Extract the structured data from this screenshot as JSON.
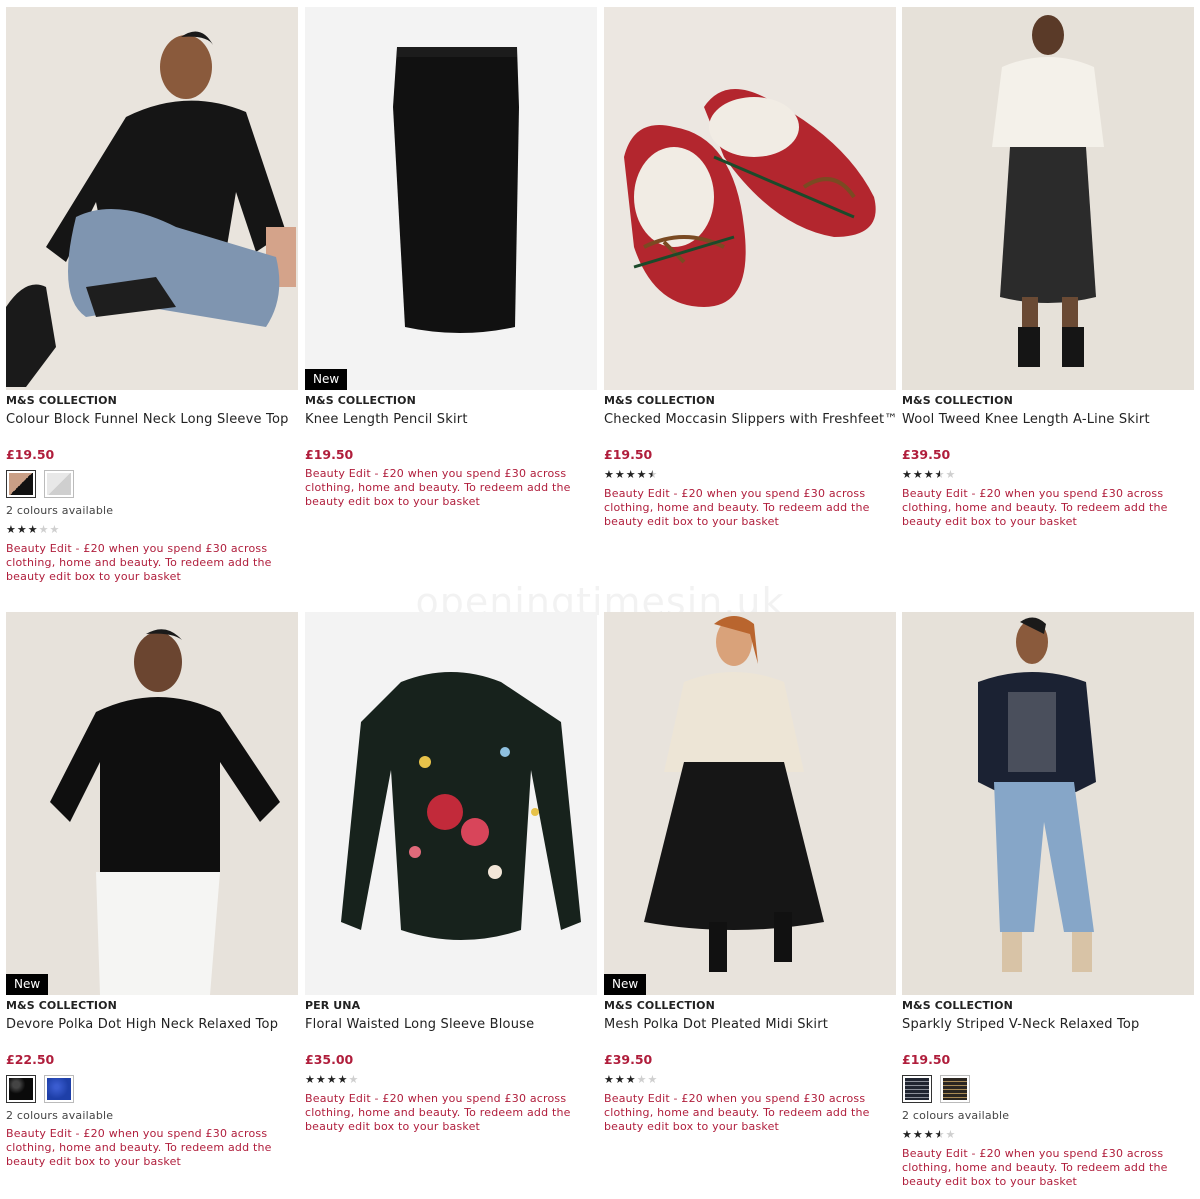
{
  "watermark": "openingtimesin.uk",
  "new_label": "New",
  "products": [
    {
      "brand": "M&S COLLECTION",
      "title": "Colour Block Funnel Neck Long Sleeve Top",
      "price": "£19.50",
      "is_new": false,
      "swatches": [
        "#c99f86",
        "#dcdcdc"
      ],
      "colours_text": "2 colours available",
      "rating": 3,
      "promo": "Beauty Edit - £20 when you spend £30 across clothing, home and beauty. To redeem add the beauty edit box to your basket"
    },
    {
      "brand": "M&S COLLECTION",
      "title": "Knee Length Pencil Skirt",
      "price": "£19.50",
      "is_new": true,
      "swatches": [],
      "colours_text": "",
      "rating": null,
      "promo": "Beauty Edit - £20 when you spend £30 across clothing, home and beauty. To redeem add the beauty edit box to your basket"
    },
    {
      "brand": "M&S COLLECTION",
      "title": "Checked Moccasin Slippers with Freshfeet™",
      "price": "£19.50",
      "is_new": false,
      "swatches": [],
      "colours_text": "",
      "rating": 4.5,
      "promo": "Beauty Edit - £20 when you spend £30 across clothing, home and beauty. To redeem add the beauty edit box to your basket"
    },
    {
      "brand": "M&S COLLECTION",
      "title": "Wool Tweed Knee Length A-Line Skirt",
      "price": "£39.50",
      "is_new": false,
      "swatches": [],
      "colours_text": "",
      "rating": 3.5,
      "promo": "Beauty Edit - £20 when you spend £30 across clothing, home and beauty. To redeem add the beauty edit box to your basket"
    },
    {
      "brand": "M&S COLLECTION",
      "title": "Devore Polka Dot High Neck Relaxed Top",
      "price": "£22.50",
      "is_new": true,
      "swatches": [
        "#111111",
        "#1e3fa8"
      ],
      "colours_text": "2 colours available",
      "rating": null,
      "promo": "Beauty Edit - £20 when you spend £30 across clothing, home and beauty. To redeem add the beauty edit box to your basket"
    },
    {
      "brand": "PER UNA",
      "title": "Floral Waisted Long Sleeve Blouse",
      "price": "£35.00",
      "is_new": false,
      "swatches": [],
      "colours_text": "",
      "rating": 4,
      "promo": "Beauty Edit - £20 when you spend £30 across clothing, home and beauty. To redeem add the beauty edit box to your basket"
    },
    {
      "brand": "M&S COLLECTION",
      "title": "Mesh Polka Dot Pleated Midi Skirt",
      "price": "£39.50",
      "is_new": true,
      "swatches": [],
      "colours_text": "",
      "rating": 3,
      "promo": "Beauty Edit - £20 when you spend £30 across clothing, home and beauty. To redeem add the beauty edit box to your basket"
    },
    {
      "brand": "M&S COLLECTION",
      "title": "Sparkly Striped V-Neck Relaxed Top",
      "price": "£19.50",
      "is_new": false,
      "swatches": [
        "#2a2f3a",
        "#4a4236"
      ],
      "colours_text": "2 colours available",
      "rating": 3.5,
      "promo": "Beauty Edit - £20 when you spend £30 across clothing, home and beauty. To redeem add the beauty edit box to your basket"
    }
  ]
}
